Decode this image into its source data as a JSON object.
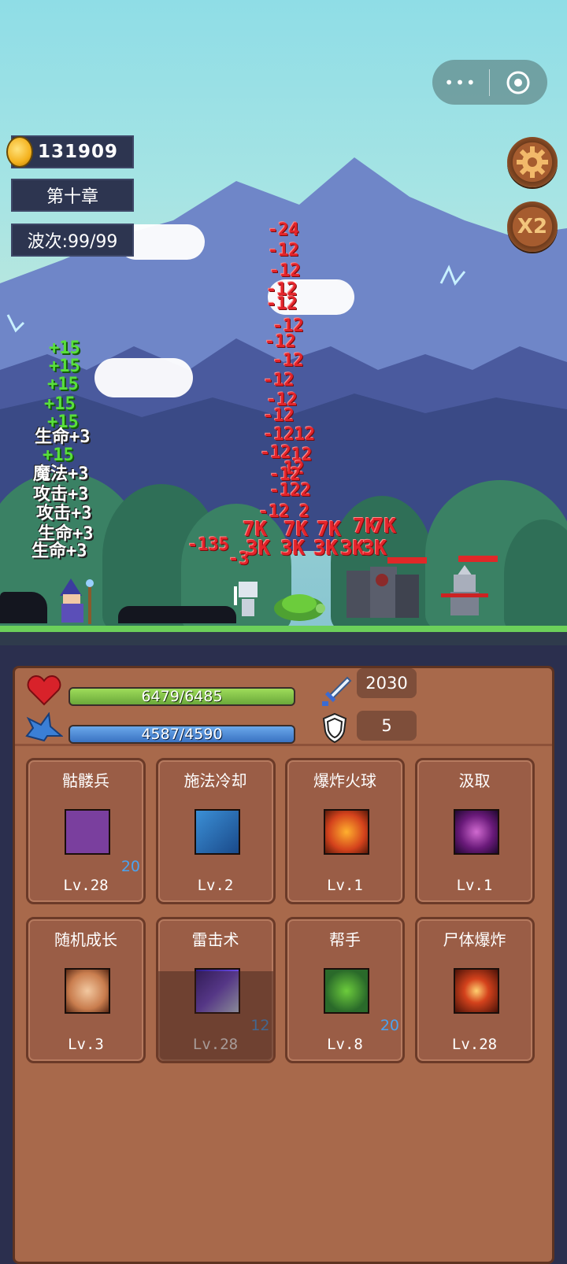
{
  "hud": {
    "coins": "131909",
    "chapter": "第十章",
    "wave": "波次:99/99",
    "speed_label": "X2"
  },
  "miniprogram": {
    "more_icon": "more-dots-icon",
    "close_icon": "target-circle-icon"
  },
  "floating": {
    "damage": [
      "-24",
      "-12",
      "-12",
      "-12",
      "-12",
      "-12",
      "-12",
      "-12",
      "-12",
      "-12",
      "-12",
      "-1212",
      "-12",
      "12",
      "12",
      "-12",
      "-122",
      "-12",
      "2",
      "-135",
      "-3",
      "7K",
      "7K",
      "7K",
      "7K",
      "7K",
      "3K",
      "3K",
      "3K",
      "3K",
      "3K"
    ],
    "heal": [
      "+15",
      "+15",
      "+15",
      "+15",
      "+15",
      "+15"
    ],
    "stats": [
      "生命+3",
      "魔法+3",
      "攻击+3",
      "攻击+3",
      "生命+3",
      "生命+3"
    ]
  },
  "player": {
    "hp_text": "6479/6485",
    "hp_fraction": 0.999,
    "mp_text": "4587/4590",
    "mp_fraction": 0.999,
    "attack": "2030",
    "defense": "5"
  },
  "skills": [
    {
      "name": "骷髅兵",
      "level": "Lv.28",
      "badge": "20",
      "icon": "skeleton-hand-icon"
    },
    {
      "name": "施法冷却",
      "level": "Lv.2",
      "badge": "",
      "icon": "lightning-cooldown-icon"
    },
    {
      "name": "爆炸火球",
      "level": "Lv.1",
      "badge": "",
      "icon": "fireball-icon"
    },
    {
      "name": "汲取",
      "level": "Lv.1",
      "badge": "",
      "icon": "vortex-icon"
    },
    {
      "name": "随机成长",
      "level": "Lv.3",
      "badge": "",
      "icon": "fist-icon"
    },
    {
      "name": "雷击术",
      "level": "Lv.28",
      "badge": "12",
      "icon": "lightning-strike-icon"
    },
    {
      "name": "帮手",
      "level": "Lv.8",
      "badge": "20",
      "icon": "turtle-helper-icon"
    },
    {
      "name": "尸体爆炸",
      "level": "Lv.28",
      "badge": "",
      "icon": "corpse-explosion-icon"
    }
  ],
  "colors": {
    "hp": "#7cc44a",
    "mp": "#4a88d0",
    "panel": "#a8694b"
  }
}
